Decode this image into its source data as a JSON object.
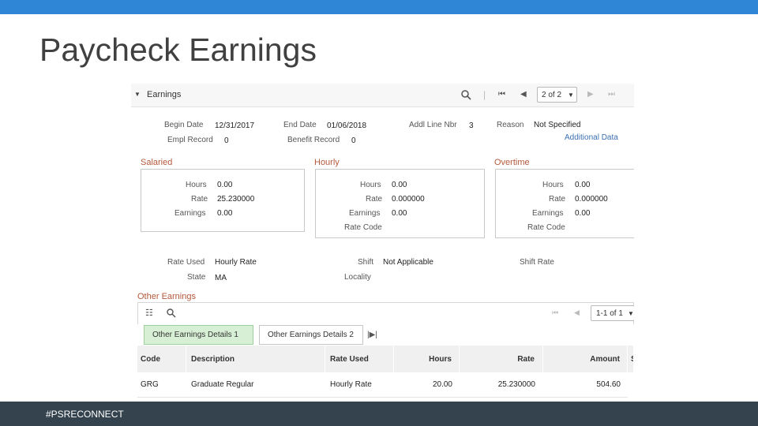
{
  "slide": {
    "title": "Paycheck Earnings",
    "footer": "#PSRECONNECT"
  },
  "earnings": {
    "title": "Earnings",
    "pager": "2 of 2",
    "fields": {
      "begin_date_label": "Begin Date",
      "begin_date": "12/31/2017",
      "end_date_label": "End Date",
      "end_date": "01/06/2018",
      "addl_line_label": "Addl Line Nbr",
      "addl_line": "3",
      "reason_label": "Reason",
      "reason": "Not Specified",
      "empl_record_label": "Empl Record",
      "empl_record": "0",
      "benefit_record_label": "Benefit Record",
      "benefit_record": "0",
      "additional_data": "Additional Data"
    },
    "salaried": {
      "title": "Salaried",
      "hours_label": "Hours",
      "hours": "0.00",
      "rate_label": "Rate",
      "rate": "25.230000",
      "earnings_label": "Earnings",
      "earnings": "0.00"
    },
    "hourly": {
      "title": "Hourly",
      "hours_label": "Hours",
      "hours": "0.00",
      "rate_label": "Rate",
      "rate": "0.000000",
      "earnings_label": "Earnings",
      "earnings": "0.00",
      "rate_code_label": "Rate Code"
    },
    "overtime": {
      "title": "Overtime",
      "hours_label": "Hours",
      "hours": "0.00",
      "rate_label": "Rate",
      "rate": "0.000000",
      "earnings_label": "Earnings",
      "earnings": "0.00",
      "rate_code_label": "Rate Code"
    },
    "rate_used_label": "Rate Used",
    "rate_used": "Hourly Rate",
    "shift_label": "Shift",
    "shift": "Not Applicable",
    "shift_rate_label": "Shift Rate",
    "state_label": "State",
    "state": "MA",
    "locality_label": "Locality"
  },
  "other_earnings": {
    "title": "Other Earnings",
    "pager": "1-1 of 1",
    "tabs": [
      "Other Earnings Details 1",
      "Other Earnings Details 2"
    ],
    "columns": [
      "Code",
      "Description",
      "Rate Used",
      "Hours",
      "Rate",
      "Amount",
      "S"
    ],
    "rows": [
      {
        "code": "GRG",
        "description": "Graduate Regular",
        "rate_used": "Hourly Rate",
        "hours": "20.00",
        "rate": "25.230000",
        "amount": "504.60"
      }
    ]
  }
}
